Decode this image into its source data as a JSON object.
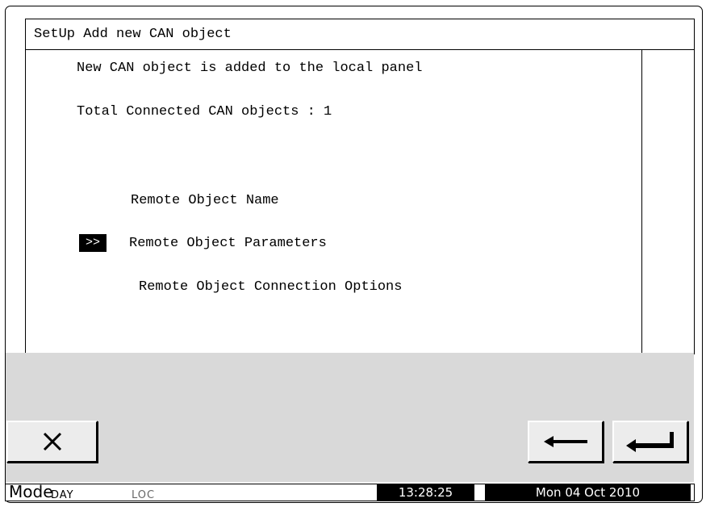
{
  "title": "SetUp Add new CAN object",
  "message": "New CAN object is added to the local panel",
  "total_connected": "Total Connected CAN objects : 1",
  "menu": {
    "cursor": ">>",
    "items": [
      {
        "label": "Remote Object Name"
      },
      {
        "label": "Remote Object Parameters"
      },
      {
        "label": "Remote Object Connection Options"
      }
    ]
  },
  "buttons": {
    "cancel_icon": "close-x-icon",
    "back_icon": "arrow-left-icon",
    "enter_icon": "enter-return-icon"
  },
  "status": {
    "mode_label": "Mode",
    "mode_value": "DAY",
    "location": "LOC",
    "time": "13:28:25",
    "date": "Mon 04 Oct 2010"
  },
  "colors": {
    "panel_gray": "#d9d9d9",
    "highlight": "#000000"
  }
}
